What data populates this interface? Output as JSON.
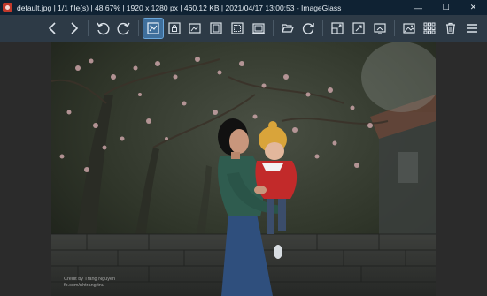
{
  "window": {
    "title": "default.jpg  |  1/1 file(s)  |  48.67%  |  1920 x 1280 px  |  460.12 KB  |  2021/04/17 13:00:53  -  ImageGlass",
    "controls": {
      "minimize": "—",
      "maximize": "☐",
      "close": "✕"
    }
  },
  "toolbar": {
    "buttons": [
      {
        "name": "previous-image",
        "icon": "chevron-left-icon"
      },
      {
        "name": "next-image",
        "icon": "chevron-right-icon"
      },
      {
        "name": "rotate-left",
        "icon": "rotate-left-icon"
      },
      {
        "name": "rotate-right",
        "icon": "rotate-right-icon"
      },
      {
        "name": "auto-zoom",
        "icon": "auto-zoom-icon",
        "active": true
      },
      {
        "name": "lock-zoom",
        "icon": "lock-zoom-icon"
      },
      {
        "name": "scale-to-width",
        "icon": "scale-width-icon"
      },
      {
        "name": "scale-to-height",
        "icon": "scale-height-icon"
      },
      {
        "name": "scale-to-fit",
        "icon": "scale-fit-icon"
      },
      {
        "name": "scale-to-fill",
        "icon": "scale-fill-icon"
      },
      {
        "name": "open-file",
        "icon": "open-folder-icon"
      },
      {
        "name": "refresh",
        "icon": "refresh-icon"
      },
      {
        "name": "window-fit",
        "icon": "window-fit-icon"
      },
      {
        "name": "fullscreen",
        "icon": "fullscreen-icon"
      },
      {
        "name": "slideshow",
        "icon": "slideshow-icon"
      },
      {
        "name": "set-wallpaper",
        "icon": "image-icon"
      },
      {
        "name": "thumbnail-bar",
        "icon": "thumbnail-grid-icon"
      },
      {
        "name": "delete",
        "icon": "trash-icon"
      }
    ],
    "menu_icon": "hamburger-menu-icon"
  },
  "image": {
    "credit_line1": "Credit by Trang Nguyen",
    "credit_line2": "fb.com/nhtrang.tnu"
  }
}
